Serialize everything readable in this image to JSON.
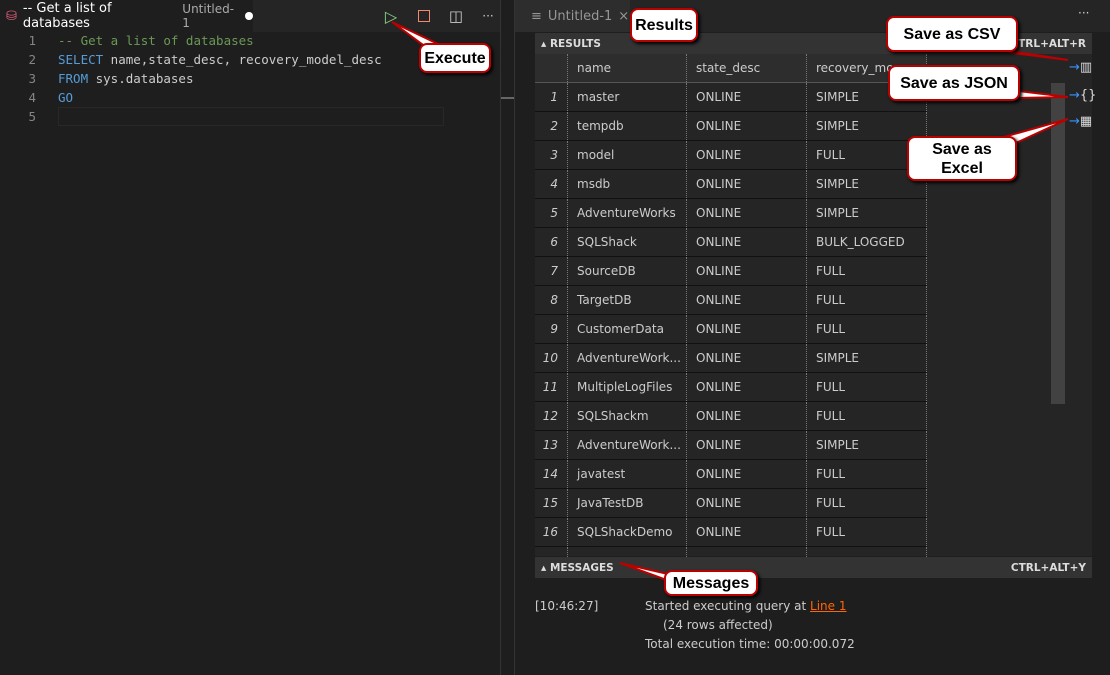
{
  "editor": {
    "tab_title": "-- Get a list of databases",
    "tab_file": "Untitled-1",
    "lines": [
      {
        "n": "1",
        "text": "-- Get a list of databases"
      },
      {
        "n": "2",
        "kw": "SELECT",
        "text": " name,state_desc, recovery_model_desc"
      },
      {
        "n": "3",
        "kw": "FROM",
        "text": " sys.databases"
      },
      {
        "n": "4",
        "kw": "GO",
        "text": ""
      },
      {
        "n": "5",
        "text": ""
      }
    ],
    "toolbar": {
      "run": "▷",
      "stop": "□",
      "split": "◫",
      "more": "···"
    }
  },
  "results_tab": {
    "label": "Untitled-1",
    "close": "×",
    "more": "···"
  },
  "results": {
    "header": "RESULTS",
    "shortcut": "CTRL+ALT+R",
    "columns": [
      "name",
      "state_desc",
      "recovery_mo"
    ],
    "rows": [
      [
        "1",
        "master",
        "ONLINE",
        "SIMPLE"
      ],
      [
        "2",
        "tempdb",
        "ONLINE",
        "SIMPLE"
      ],
      [
        "3",
        "model",
        "ONLINE",
        "FULL"
      ],
      [
        "4",
        "msdb",
        "ONLINE",
        "SIMPLE"
      ],
      [
        "5",
        "AdventureWorks",
        "ONLINE",
        "SIMPLE"
      ],
      [
        "6",
        "SQLShack",
        "ONLINE",
        "BULK_LOGGED"
      ],
      [
        "7",
        "SourceDB",
        "ONLINE",
        "FULL"
      ],
      [
        "8",
        "TargetDB",
        "ONLINE",
        "FULL"
      ],
      [
        "9",
        "CustomerData",
        "ONLINE",
        "FULL"
      ],
      [
        "10",
        "AdventureWork...",
        "ONLINE",
        "SIMPLE"
      ],
      [
        "11",
        "MultipleLogFiles",
        "ONLINE",
        "FULL"
      ],
      [
        "12",
        "SQLShackm",
        "ONLINE",
        "FULL"
      ],
      [
        "13",
        "AdventureWork...",
        "ONLINE",
        "SIMPLE"
      ],
      [
        "14",
        "javatest",
        "ONLINE",
        "FULL"
      ],
      [
        "15",
        "JavaTestDB",
        "ONLINE",
        "FULL"
      ],
      [
        "16",
        "SQLShackDemo",
        "ONLINE",
        "FULL"
      ]
    ]
  },
  "messages": {
    "header": "MESSAGES",
    "shortcut": "CTRL+ALT+Y",
    "time": "[10:46:27]",
    "started": "Started executing query at ",
    "link": "Line 1",
    "rows": "(24 rows affected)",
    "total": "Total execution time: 00:00:00.072"
  },
  "callouts": {
    "execute": "Execute",
    "results": "Results",
    "csv": "Save as CSV",
    "json": "Save as JSON",
    "excel": "Save as Excel",
    "messages": "Messages"
  },
  "colors": {
    "accent_link": "#ff6600",
    "callout_border": "#bb0000",
    "comment": "#6a9955",
    "keyword": "#569cd6"
  }
}
